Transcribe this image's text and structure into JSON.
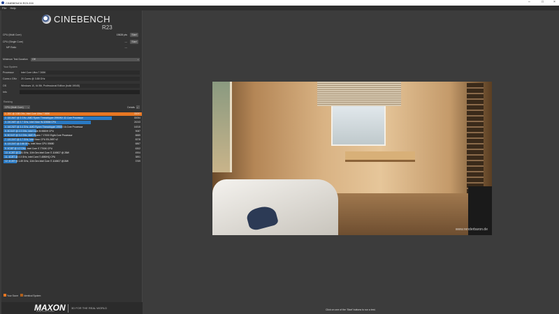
{
  "window": {
    "title": "CINEBENCH R23.200",
    "controls": [
      "minimize",
      "maximize",
      "close"
    ]
  },
  "menu": [
    "File",
    "Help"
  ],
  "brand": {
    "name": "CINEBENCH",
    "version": "R23"
  },
  "tests": [
    {
      "label": "CPU (Multi Core)",
      "score": "15626 pts",
      "button": "Start"
    },
    {
      "label": "CPU (Single Core)",
      "score": "---",
      "button": "Start"
    },
    {
      "label": "MP Ratio",
      "score": "---"
    }
  ],
  "min_duration": {
    "label": "Minimum Test Duration",
    "value": "Off"
  },
  "system": {
    "title": "Your System",
    "fields": [
      {
        "label": "Processor",
        "value": "Intel Core Ultra 7 265K"
      },
      {
        "label": "Cores x GHz",
        "value": "20 Cores @ 3.88 GHz"
      },
      {
        "label": "OS",
        "value": "Windows 10, 64 Bit, Professional Edition (build 19045)"
      },
      {
        "label": "Info",
        "value": ""
      }
    ]
  },
  "ranking": {
    "title": "Ranking",
    "dropdown": "CPU (Multi Core)",
    "details": "Details",
    "rows": [
      {
        "label": "1. 20C @ 3.88 GHz, Intel Core Ultra 7 265K",
        "score": "33097",
        "mine": true
      },
      {
        "label": "2. 32C/64T @ 3 GHz, AMD Ryzen Threadripper 2990WX 32-Core Processor",
        "score": "30054"
      },
      {
        "label": "3. 24C/48T @ 2.7 GHz, Intel Xeon W-3265M CPU",
        "score": "24243"
      },
      {
        "label": "4. 16C/32T @ 3.4 GHz, AMD Ryzen Threadripper 1950X 16-Core Processor",
        "score": "16315"
      },
      {
        "label": "5. 8C/16T @ 2.3 GHz, Intel Core i9-9880H CPU",
        "score": "9087"
      },
      {
        "label": "6. 8C/16T @ 3.4 GHz, AMD Ryzen 7 1700X Eight-Core Processor",
        "score": "8889"
      },
      {
        "label": "7. 12C/24T @ 2.7 GHz, Intel Xeon CPU E5-2697 v2",
        "score": "8378"
      },
      {
        "label": "8. 12C/24T @ 2.66 GHz, Intel Xeon CPU X5650",
        "score": "6867"
      },
      {
        "label": "9. 4C/8T @ 4.2 GHz, Intel Core i7-7700K CPU",
        "score": "6302"
      },
      {
        "label": "10. 4C/8T @ 2.81 GHz, 11th Gen Intel Core i7-1165G7 @ 28W",
        "score": "4904"
      },
      {
        "label": "11. 4C/8T @ 2.3 GHz, Intel Core i7-4850HQ CPU",
        "score": "3891"
      },
      {
        "label": "12. 4C/8T @ 1.69 GHz, 11th Gen Intel Core i7-1165G7 @15W",
        "score": "3769"
      }
    ]
  },
  "legend": [
    {
      "label": "Your Score",
      "color": "#e87722"
    },
    {
      "label": "Identical System",
      "color": "#b0601c"
    }
  ],
  "footer": {
    "logo": "MAXON",
    "logo_sub": "A NEMETSCHEK COMPANY",
    "tagline": "3D FOR THE REAL WORLD"
  },
  "status": "Click on one of the 'Start' buttons to run a test.",
  "render": {
    "watermark": "www.renderbaron.de"
  },
  "colors": {
    "accent": "#e87722",
    "bar": "#2a7ac4"
  }
}
